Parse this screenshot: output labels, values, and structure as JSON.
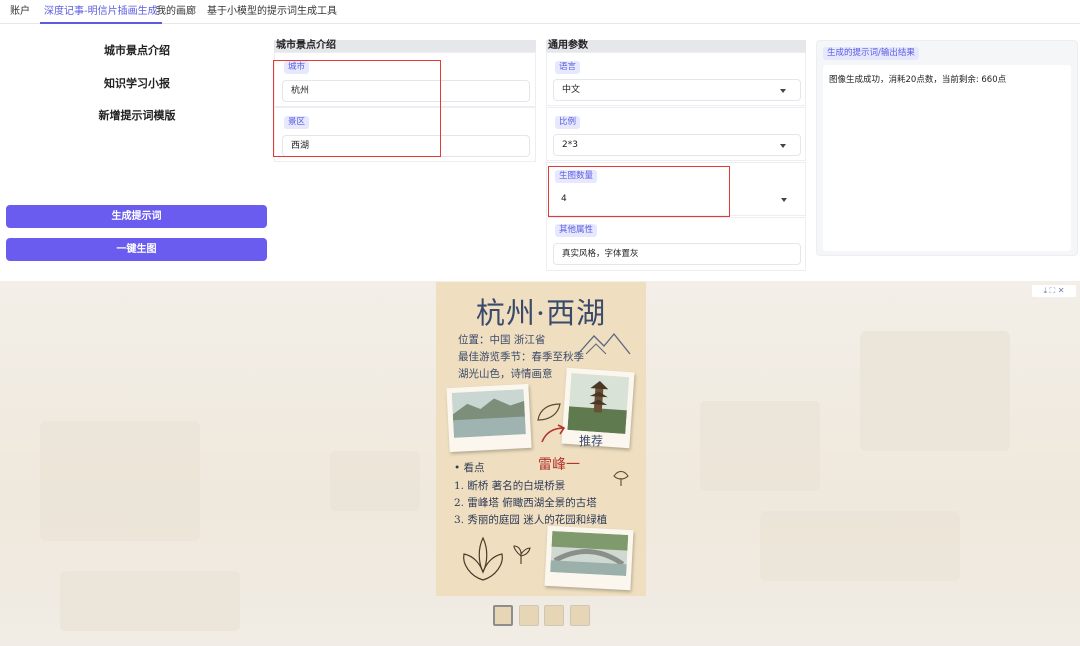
{
  "tabs": [
    {
      "label": "账户"
    },
    {
      "label": "深度记事-明信片插画生成"
    },
    {
      "label": "我的画廊"
    },
    {
      "label": "基于小模型的提示词生成工具"
    }
  ],
  "sidebar": {
    "items": [
      {
        "label": "城市景点介绍"
      },
      {
        "label": "知识学习小报"
      },
      {
        "label": "新增提示词模版"
      }
    ],
    "generate_prompt_button": "生成提示词",
    "generate_image_button": "一键生图"
  },
  "city_panel": {
    "title": "城市景点介绍",
    "city_label": "城市",
    "city_value": "杭州",
    "scenic_label": "景区",
    "scenic_value": "西湖"
  },
  "params_panel": {
    "title": "通用参数",
    "language_label": "语言",
    "language_value": "中文",
    "ratio_label": "比例",
    "ratio_value": "2*3",
    "count_label": "生图数量",
    "count_value": "4",
    "other_label": "其他属性",
    "other_value": "真实风格，字体置灰"
  },
  "result_panel": {
    "title": "生成的提示词/输出结果",
    "text": "图像生成成功，消耗20点数，当前剩余: 660点"
  },
  "poster": {
    "title": "杭州·西湖",
    "location": "位置：中国 浙江省",
    "season": "最佳游览季节：春季至秋季",
    "tagline": "湖光山色，诗情画意",
    "recommend": "推荐",
    "leifeng": "雷峰一",
    "section": "• 看点",
    "list": [
      "1. 断桥   著名的白堤桥景",
      "2. 雷峰塔 俯瞰西湖全景的古塔",
      "3. 秀丽的庭园 迷人的花园和绿植"
    ]
  },
  "gallery": {
    "corner_icons": "⤓ ⛶ ✕"
  },
  "colors": {
    "accent": "#5b5ce2",
    "primary_button": "#6b5cf0",
    "highlight_box": "#e53935",
    "poster_bg": "#efdfc0"
  }
}
